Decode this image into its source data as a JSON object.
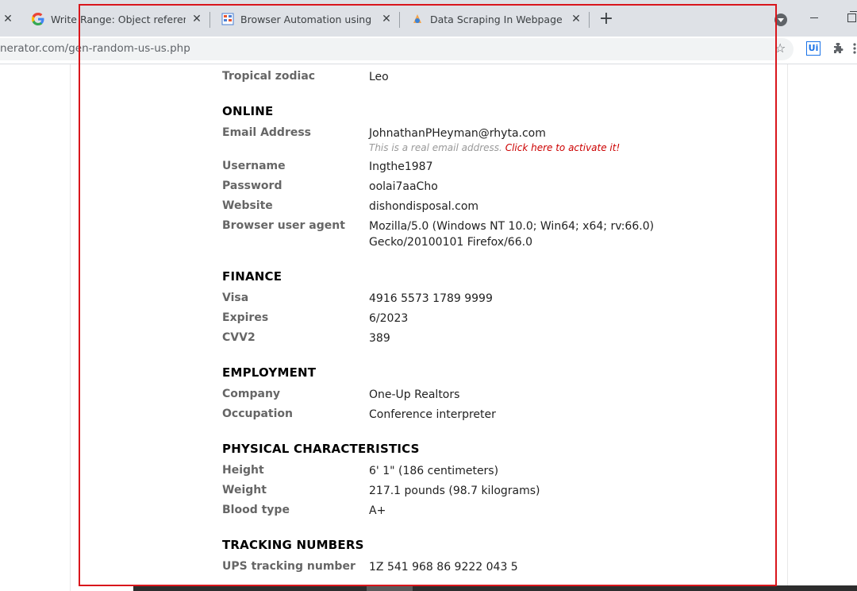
{
  "browser": {
    "tabs": [
      {
        "title": "Write Range: Object reference no",
        "favicon": "google-icon"
      },
      {
        "title": "Browser Automation using UiPath",
        "favicon": "uipath-forum-icon"
      },
      {
        "title": "Data Scraping In Webpage Autom",
        "favicon": "uipath-docs-icon"
      }
    ],
    "url": "nerator.com/gen-random-us-us.php"
  },
  "profile": {
    "partial_label": "Tropical zodiac_prev",
    "tropical_zodiac": {
      "label": "Tropical zodiac",
      "value": "Leo"
    },
    "online": {
      "title": "ONLINE",
      "email": {
        "label": "Email Address",
        "value": "JohnathanPHeyman@rhyta.com",
        "note": "This is a real email address.",
        "note_link": "Click here to activate it!"
      },
      "username": {
        "label": "Username",
        "value": "Ingthe1987"
      },
      "password": {
        "label": "Password",
        "value": "oolai7aaCho"
      },
      "website": {
        "label": "Website",
        "value": "dishondisposal.com"
      },
      "user_agent": {
        "label": "Browser user agent",
        "value_line1": "Mozilla/5.0 (Windows NT 10.0; Win64; x64; rv:66.0)",
        "value_line2": "Gecko/20100101 Firefox/66.0"
      }
    },
    "finance": {
      "title": "FINANCE",
      "visa": {
        "label": "Visa",
        "value": "4916 5573 1789 9999"
      },
      "expires": {
        "label": "Expires",
        "value": "6/2023"
      },
      "cvv2": {
        "label": "CVV2",
        "value": "389"
      }
    },
    "employment": {
      "title": "EMPLOYMENT",
      "company": {
        "label": "Company",
        "value": "One-Up Realtors"
      },
      "occupation": {
        "label": "Occupation",
        "value": "Conference interpreter"
      }
    },
    "physical": {
      "title": "PHYSICAL CHARACTERISTICS",
      "height": {
        "label": "Height",
        "value": "6' 1\" (186 centimeters)"
      },
      "weight": {
        "label": "Weight",
        "value": "217.1 pounds (98.7 kilograms)"
      },
      "blood_type": {
        "label": "Blood type",
        "value": "A+"
      }
    },
    "tracking": {
      "title": "TRACKING NUMBERS",
      "ups": {
        "label": "UPS tracking number",
        "value": "1Z 541 968 86 9222 043 5"
      }
    }
  },
  "colors": {
    "annotation_border": "#d9161c",
    "link_red": "#cc0000",
    "tab_strip": "#dee1e6"
  }
}
